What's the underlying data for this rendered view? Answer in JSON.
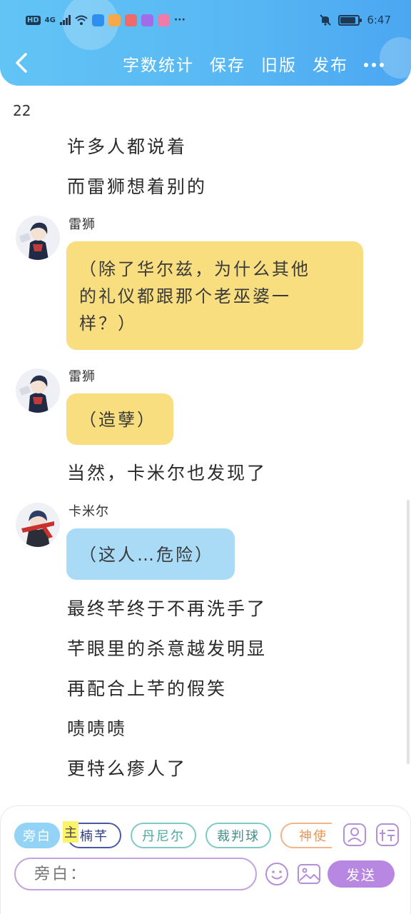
{
  "status_bar": {
    "network": "HD",
    "signal": "4G",
    "time": "6:47"
  },
  "toolbar": {
    "back_icon": "chevron-left-icon",
    "actions": [
      "字数统计",
      "保存",
      "旧版",
      "发布"
    ],
    "more_icon": "more-dots-icon"
  },
  "story": {
    "chapter": "22",
    "messages": [
      {
        "type": "narration",
        "text": "许多人都说着"
      },
      {
        "type": "narration",
        "text": "而雷狮想着别的"
      },
      {
        "type": "dialogue",
        "speaker": "雷狮",
        "lines": [
          "（除了华尔兹，为什么其他",
          "的礼仪都跟那个老巫婆一",
          "样？）"
        ],
        "color": "#f8de7e"
      },
      {
        "type": "dialogue",
        "speaker": "雷狮",
        "lines": [
          "（造孽）"
        ],
        "color": "#f8de7e"
      },
      {
        "type": "narration",
        "text": "当然，卡米尔也发现了"
      },
      {
        "type": "dialogue",
        "speaker": "卡米尔",
        "lines": [
          "（这人…危险）"
        ],
        "color": "#a9dbf7"
      },
      {
        "type": "narration",
        "text": "最终芊终于不再洗手了"
      },
      {
        "type": "narration",
        "text": "芊眼里的杀意越发明显"
      },
      {
        "type": "narration",
        "text": "再配合上芊的假笑"
      },
      {
        "type": "narration",
        "text": "啧啧啧"
      },
      {
        "type": "narration",
        "text": "更特么瘆人了"
      }
    ]
  },
  "composer": {
    "roles": [
      "旁白",
      "楠芊",
      "丹尼尔",
      "裁判球",
      "神使"
    ],
    "main_tag": "主",
    "placeholder": "旁白：",
    "send_label": "发送",
    "icons": [
      "person-card-icon",
      "tag-icon",
      "emoji-icon",
      "image-icon"
    ]
  },
  "colors": {
    "header": "#58b8f4",
    "yellow_bubble": "#f8de7e",
    "blue_bubble": "#a9dbf7",
    "send": "#b887e2"
  }
}
